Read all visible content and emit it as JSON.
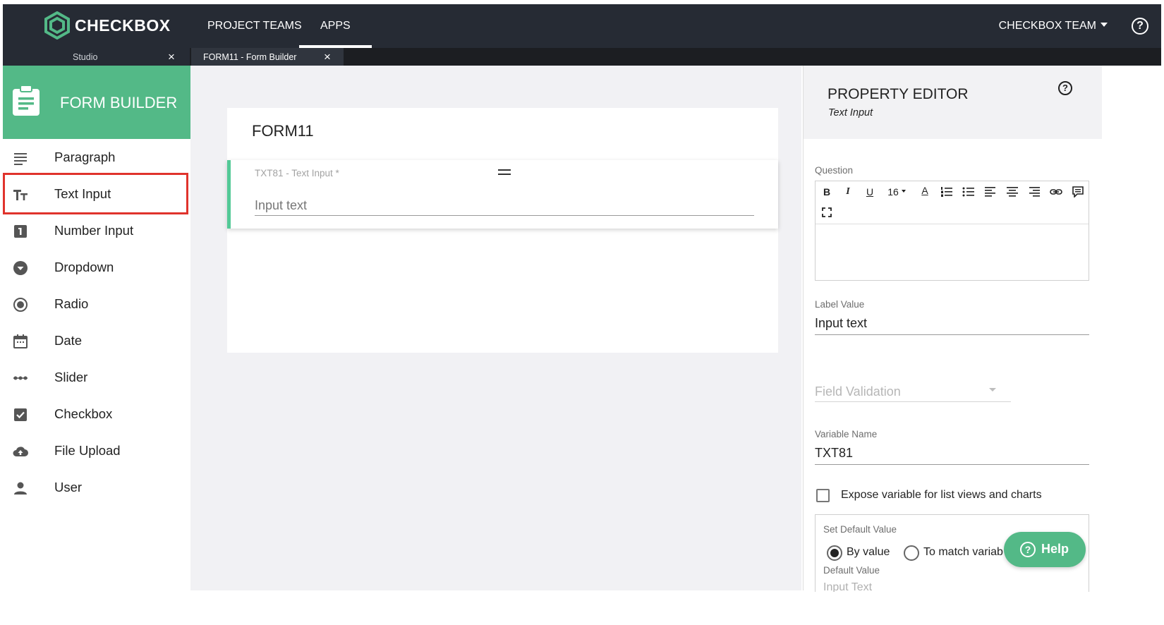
{
  "app": {
    "logo_text": "CHECKBOX",
    "nav": [
      "PROJECT TEAMS",
      "APPS"
    ],
    "active_nav": "APPS",
    "team_label": "CHECKBOX TEAM",
    "help_glyph": "?"
  },
  "tabs": [
    {
      "label": "Studio",
      "close": "×"
    },
    {
      "label": "FORM11 - Form Builder",
      "close": "×"
    }
  ],
  "sidebar": {
    "header": "FORM BUILDER",
    "items": [
      {
        "label": "Paragraph",
        "icon": "paragraph-icon"
      },
      {
        "label": "Text Input",
        "icon": "text-input-icon"
      },
      {
        "label": "Number Input",
        "icon": "number-input-icon"
      },
      {
        "label": "Dropdown",
        "icon": "dropdown-icon"
      },
      {
        "label": "Radio",
        "icon": "radio-icon"
      },
      {
        "label": "Date",
        "icon": "calendar-icon"
      },
      {
        "label": "Slider",
        "icon": "slider-icon"
      },
      {
        "label": "Checkbox",
        "icon": "checkbox-icon"
      },
      {
        "label": "File Upload",
        "icon": "cloud-upload-icon"
      },
      {
        "label": "User",
        "icon": "user-icon"
      }
    ],
    "highlighted_item": "Text Input"
  },
  "form": {
    "title": "FORM11",
    "field": {
      "tag": "TXT81 - Text Input *",
      "placeholder": "Input text"
    }
  },
  "property_editor": {
    "title": "PROPERTY EDITOR",
    "subtitle": "Text Input",
    "question_label": "Question",
    "toolbar": [
      "B",
      "I",
      "U",
      "16",
      "A"
    ],
    "label_value_label": "Label Value",
    "label_value": "Input text",
    "field_validation_placeholder": "Field Validation",
    "variable_name_label": "Variable Name",
    "variable_name": "TXT81",
    "expose_label": "Expose variable for list views and charts",
    "expose_checked": false,
    "default_section_label": "Set Default Value",
    "radio_by_value": "By value",
    "radio_match_variable": "To match variab",
    "default_value_label": "Default Value",
    "default_value_placeholder": "Input Text"
  },
  "help_button": "Help",
  "colors": {
    "nav_bg": "#262b34",
    "accent_green": "#53b987",
    "field_accent": "#53c997",
    "highlight_red": "#e0332c"
  }
}
